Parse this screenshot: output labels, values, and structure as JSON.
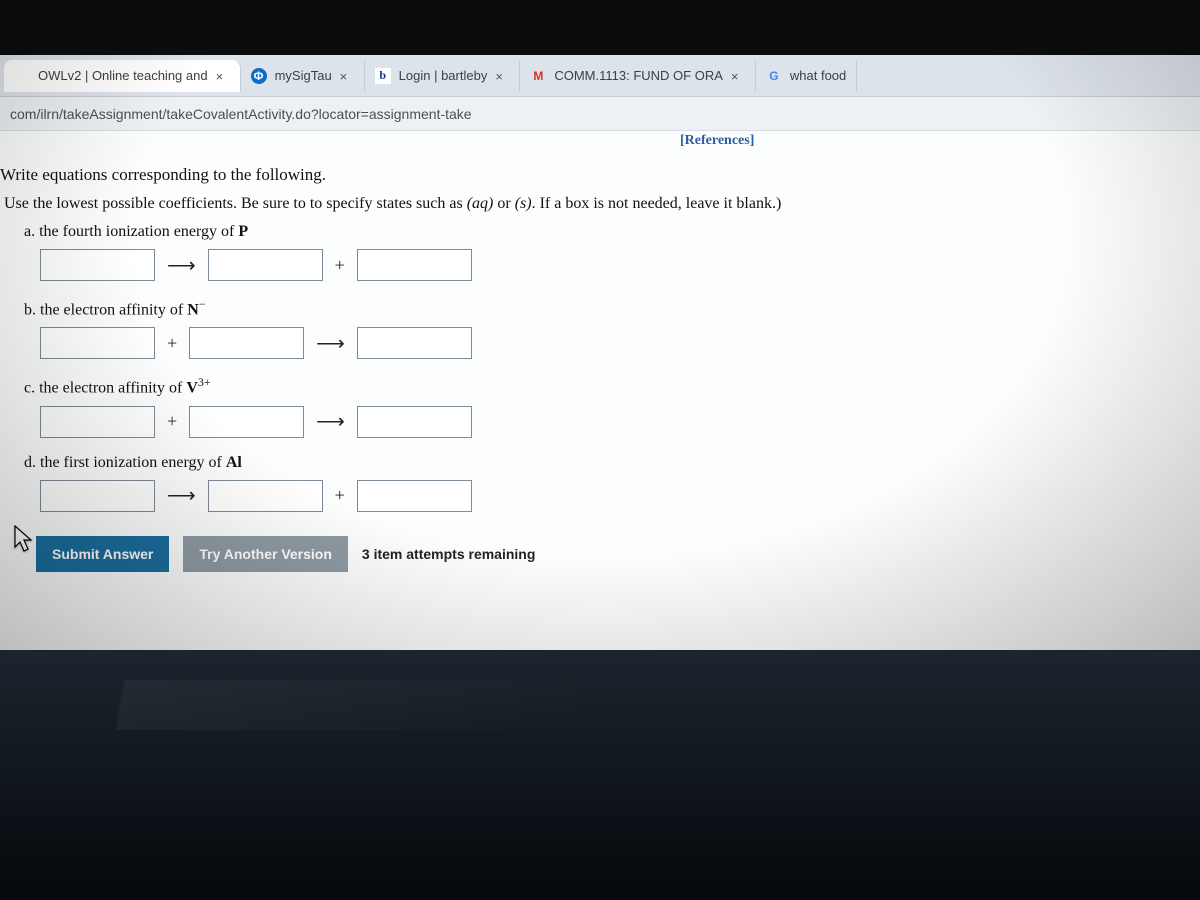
{
  "tabs": [
    {
      "title": "OWLv2 | Online teaching and",
      "faviconClass": "fav-owl",
      "faviconChar": "",
      "active": true,
      "hasClose": true
    },
    {
      "title": "mySigTau",
      "faviconClass": "fav-sigtau",
      "faviconChar": "Φ",
      "active": false,
      "hasClose": true
    },
    {
      "title": "Login | bartleby",
      "faviconClass": "fav-bartleby",
      "faviconChar": "b",
      "active": false,
      "hasClose": true
    },
    {
      "title": "COMM.1113: FUND OF ORA",
      "faviconClass": "fav-gmail",
      "faviconChar": "",
      "active": false,
      "hasClose": true
    },
    {
      "title": "what food",
      "faviconClass": "fav-google",
      "faviconChar": "",
      "active": false,
      "hasClose": false
    }
  ],
  "url": "com/ilrn/takeAssignment/takeCovalentActivity.do?locator=assignment-take",
  "references_label": "[References]",
  "prompt": "Write equations corresponding to the following.",
  "instructions_prefix": "Use the lowest possible coefficients. Be sure to to specify states such as ",
  "instructions_aq": "(aq)",
  "instructions_or": " or ",
  "instructions_s": "(s)",
  "instructions_suffix": ". If a box is not needed, leave it blank.)",
  "questions": {
    "a": {
      "prefix": "a. the fourth ionization energy of ",
      "bold": "P",
      "sup": ""
    },
    "b": {
      "prefix": "b. the electron affinity of ",
      "bold": "N",
      "sup": "−"
    },
    "c": {
      "prefix": "c. the electron affinity of ",
      "bold": "V",
      "sup": "3+"
    },
    "d": {
      "prefix": "d. the first ionization energy of ",
      "bold": "Al",
      "sup": ""
    }
  },
  "symbols": {
    "arrow": "⟶",
    "plus": "+"
  },
  "buttons": {
    "submit": "Submit Answer",
    "another": "Try Another Version"
  },
  "attempts_text": "3 item attempts remaining",
  "close_char": "×"
}
